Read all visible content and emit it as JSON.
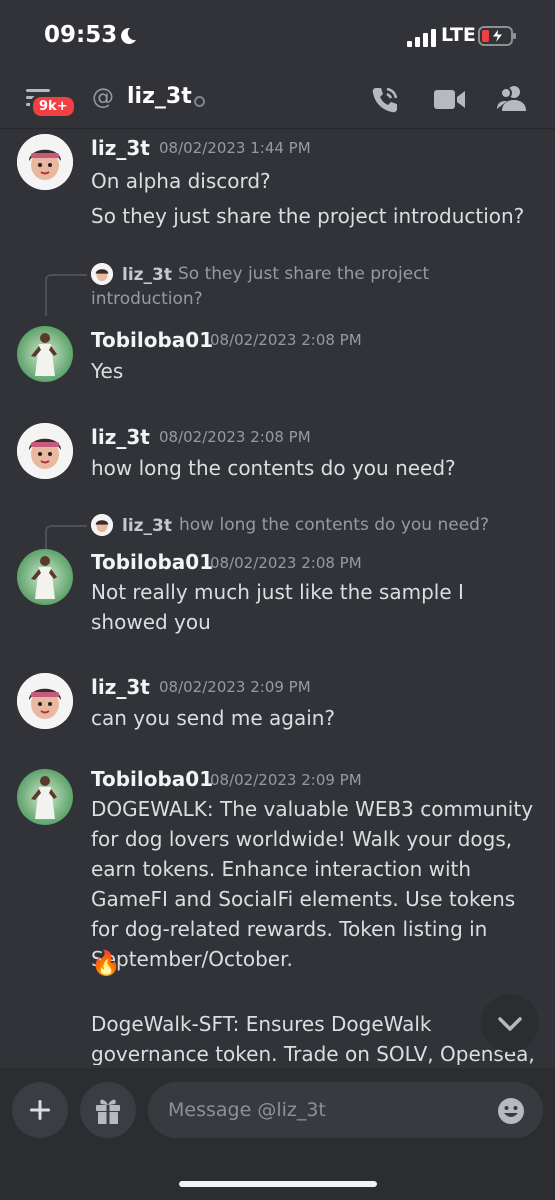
{
  "status_bar": {
    "time": "09:53",
    "network": "LTE"
  },
  "header": {
    "unread_badge": "9k+",
    "at_symbol": "@",
    "title": "liz_3t"
  },
  "messages": [
    {
      "user": "liz_3t",
      "timestamp": "08/02/2023 1:44 PM",
      "lines": [
        "On alpha discord?",
        "So they just share the project introduction?"
      ]
    },
    {
      "reply_to_user": "liz_3t",
      "reply_text": "So they just share the project introduction?",
      "user": "Tobiloba01",
      "timestamp": "08/02/2023 2:08 PM",
      "text": "Yes"
    },
    {
      "user": "liz_3t",
      "timestamp": "08/02/2023 2:08 PM",
      "text": "how long the contents do you need?"
    },
    {
      "reply_to_user": "liz_3t",
      "reply_text": "how long the contents do you need?",
      "user": "Tobiloba01",
      "timestamp": "08/02/2023 2:08 PM",
      "text": "Not really much just like the sample I showed you"
    },
    {
      "user": "liz_3t",
      "timestamp": "08/02/2023 2:09 PM",
      "text": "can you send me again?"
    },
    {
      "user": "Tobiloba01",
      "timestamp": "08/02/2023 2:09 PM",
      "text": "DOGEWALK: The valuable WEB3 community for dog lovers worldwide! Walk your dogs, earn tokens. Enhance interaction with GameFI and SocialFi elements. Use tokens for dog-related rewards. Token listing in September/October.",
      "emoji": "🔥",
      "text2": "DogeWalk-SFT: Ensures DogeWalk governance token. Trade on SOLV, Opensea, Ladder.top."
    }
  ],
  "composer": {
    "placeholder": "Message @liz_3t"
  },
  "colors": {
    "background": "#313338",
    "badge": "#f23f43",
    "composer": "#2b2d31"
  },
  "icons": [
    "moon-icon",
    "signal-icon",
    "battery-charging-icon",
    "hamburger-icon",
    "call-icon",
    "video-icon",
    "members-icon",
    "scroll-down-icon",
    "plus-icon",
    "gift-icon",
    "emoji-icon"
  ]
}
